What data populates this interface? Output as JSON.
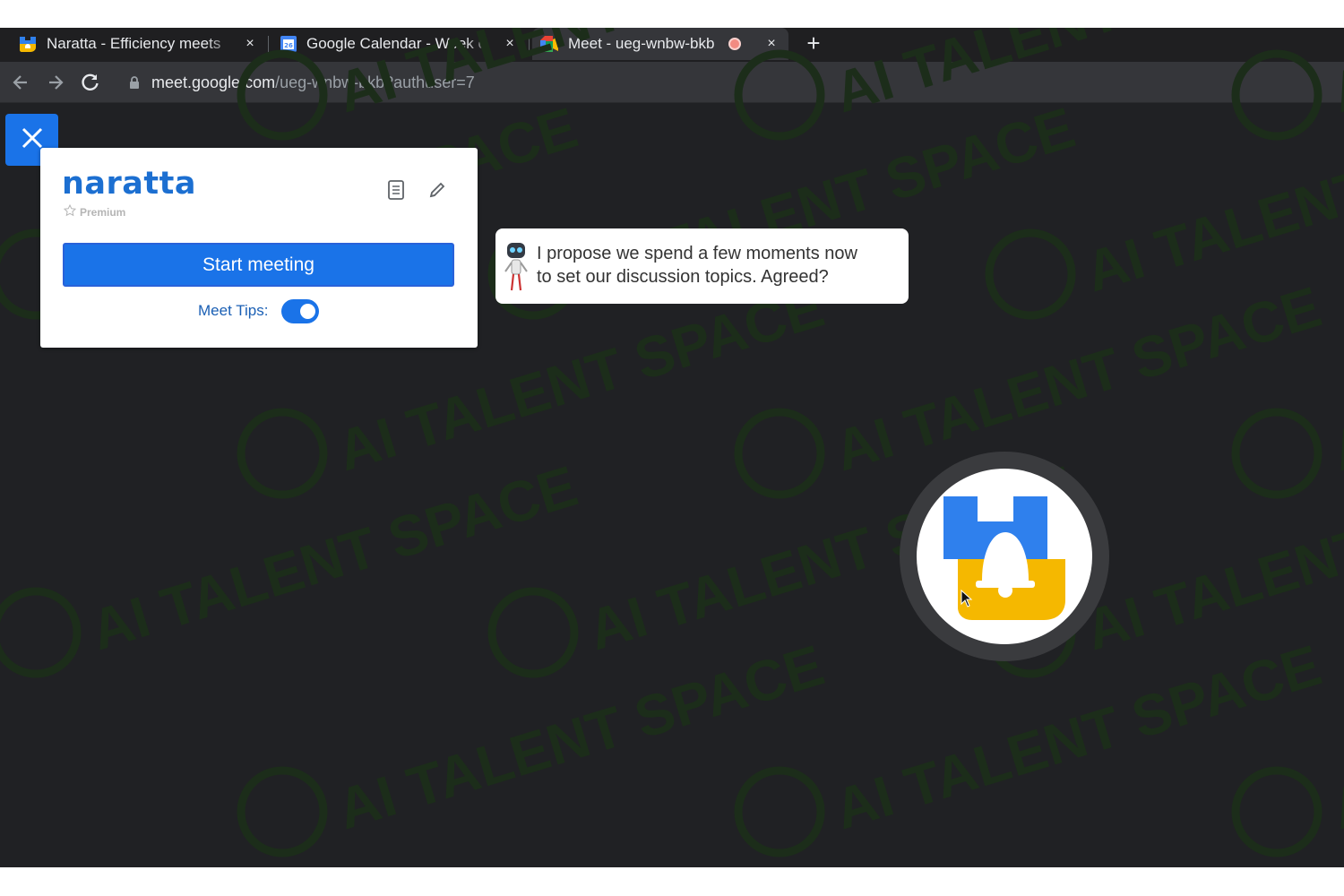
{
  "browser": {
    "tabs": [
      {
        "title": "Naratta - Efficiency meets",
        "icon": "naratta-favicon"
      },
      {
        "title": "Google Calendar - Week o",
        "icon": "calendar-favicon"
      },
      {
        "title": "Meet - ueg-wnbw-bkb",
        "icon": "meet-favicon",
        "recording": true,
        "active": true
      }
    ],
    "close_glyph": "×",
    "new_tab_glyph": "+",
    "url_host": "meet.google.com",
    "url_path": "/ueg-wnbw-bkb?authuser=7"
  },
  "panel": {
    "logo": "naratta",
    "badge": "Premium",
    "start_label": "Start meeting",
    "tips_label": "Meet Tips:",
    "tips_enabled": true
  },
  "tip": {
    "line1": "I propose we spend a few moments now",
    "line2": "to set our discussion topics. Agreed?"
  },
  "watermark": {
    "text": "AI TALENT SPACE",
    "color": "#1c2d1a"
  },
  "colors": {
    "accent": "#1a73e8",
    "brand_blue": "#2f80ed",
    "brand_yellow": "#f5b800",
    "recording": "#f28b82"
  },
  "icons": [
    "back-arrow-icon",
    "forward-arrow-icon",
    "reload-icon",
    "lock-icon",
    "close-icon",
    "document-icon",
    "pencil-icon",
    "star-icon",
    "robot-icon",
    "naratta-bell-logo",
    "cursor-icon"
  ]
}
